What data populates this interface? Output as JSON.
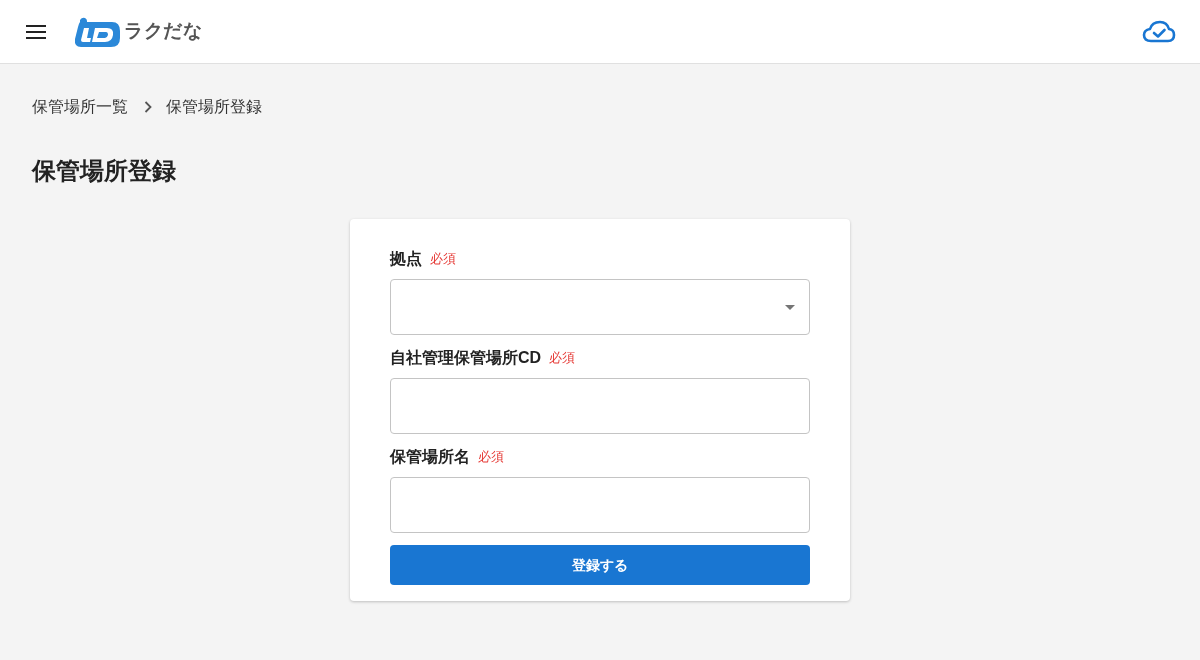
{
  "header": {
    "logo_text": "ラクだな"
  },
  "breadcrumb": [
    {
      "label": "保管場所一覧"
    },
    {
      "label": "保管場所登録"
    }
  ],
  "page_title": "保管場所登録",
  "form": {
    "fields": [
      {
        "label": "拠点",
        "required_mark": "必須",
        "kind": "select"
      },
      {
        "label": "自社管理保管場所CD",
        "required_mark": "必須",
        "kind": "text"
      },
      {
        "label": "保管場所名",
        "required_mark": "必須",
        "kind": "text"
      }
    ],
    "submit": "登録する"
  }
}
